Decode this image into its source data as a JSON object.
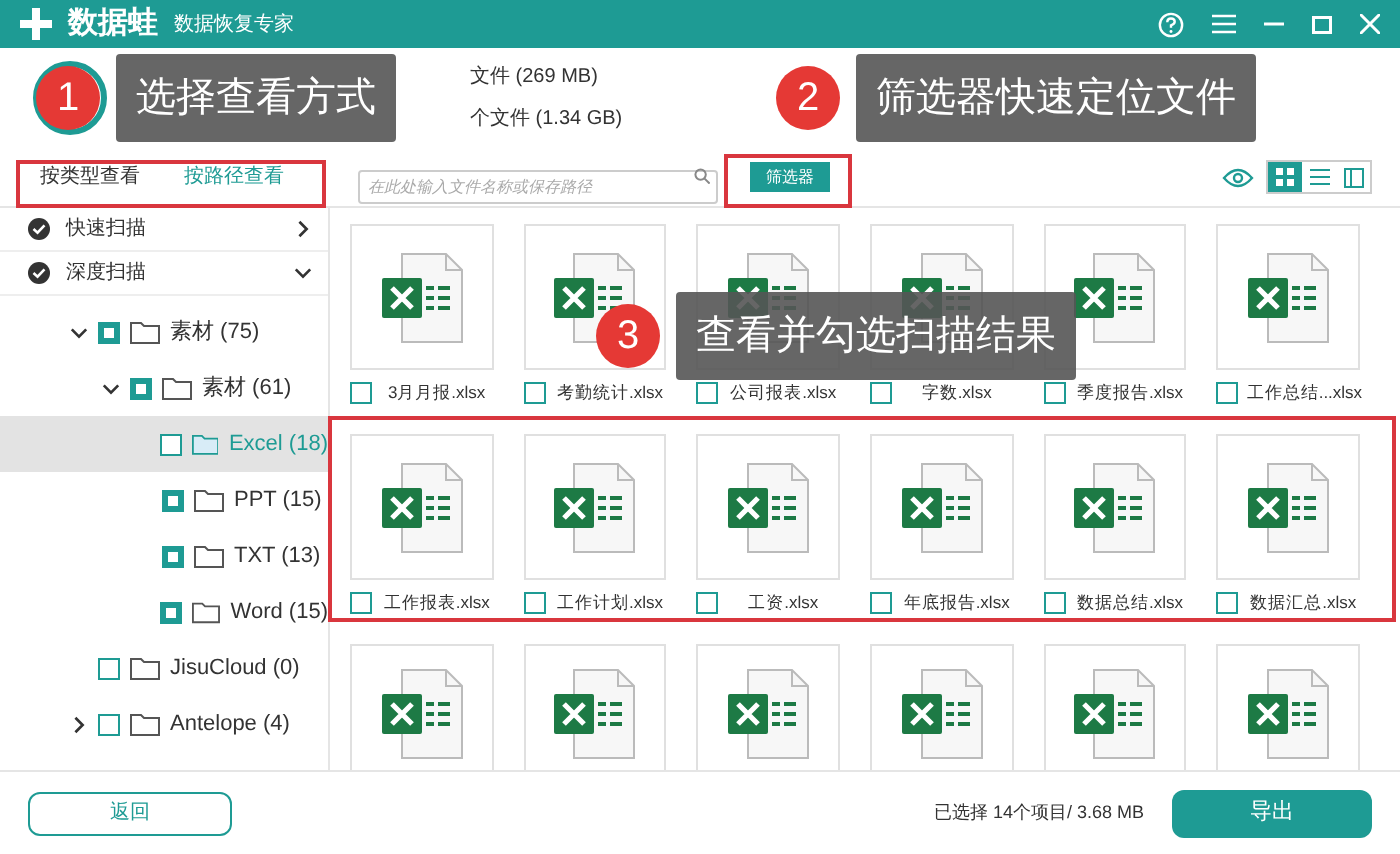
{
  "window": {
    "app_name": "数据蛙",
    "subtitle": "数据恢复专家"
  },
  "summary": [
    "文件 (269 MB)",
    "个文件 (1.34 GB)"
  ],
  "view_tabs": [
    {
      "label": "按类型查看",
      "selected": false
    },
    {
      "label": "按路径查看",
      "selected": true
    }
  ],
  "search": {
    "placeholder": "在此处输入文件名称或保存路径"
  },
  "filter_button": "筛选器",
  "view_modes": [
    {
      "kind": "grid",
      "selected": true
    },
    {
      "kind": "list",
      "selected": false
    },
    {
      "kind": "detail",
      "selected": false
    }
  ],
  "scan_modes": [
    {
      "label": "快速扫描",
      "expanded": false
    },
    {
      "label": "深度扫描",
      "expanded": true
    }
  ],
  "tree": [
    {
      "label": "素材 (75)",
      "checked": true,
      "expanded": true,
      "selected": false,
      "children": [
        {
          "label": "素材 (61)",
          "checked": true,
          "expanded": true,
          "selected": false,
          "children": [
            {
              "label": "Excel (18)",
              "checked": false,
              "selected": true
            },
            {
              "label": "PPT (15)",
              "checked": true,
              "selected": false
            },
            {
              "label": "TXT (13)",
              "checked": true,
              "selected": false
            },
            {
              "label": "Word (15)",
              "checked": true,
              "selected": false
            }
          ]
        }
      ]
    },
    {
      "label": "JisuCloud (0)",
      "checked": false,
      "selected": false
    },
    {
      "label": "Antelope (4)",
      "checked": false,
      "expanded": false,
      "selected": false,
      "expandable": true
    }
  ],
  "files": [
    {
      "kind": "named",
      "name": "3月月报.xlsx",
      "checked": false
    },
    {
      "kind": "named",
      "name": "考勤统计.xlsx",
      "checked": false
    },
    {
      "kind": "named",
      "name": "公司报表.xlsx",
      "checked": false
    },
    {
      "kind": "named",
      "name": "字数.xlsx",
      "checked": false
    },
    {
      "kind": "named",
      "name": "季度报告.xlsx",
      "checked": false
    },
    {
      "kind": "named",
      "name": "工作总结...xlsx",
      "checked": false
    },
    {
      "kind": "named",
      "name": "工作报表.xlsx",
      "checked": false
    },
    {
      "kind": "named",
      "name": "工作计划.xlsx",
      "checked": false
    },
    {
      "kind": "named",
      "name": "工资.xlsx",
      "checked": false
    },
    {
      "kind": "named",
      "name": "年底报告.xlsx",
      "checked": false
    },
    {
      "kind": "named",
      "name": "数据总结.xlsx",
      "checked": false
    },
    {
      "kind": "named",
      "name": "数据汇总.xlsx",
      "checked": false
    },
    {
      "kind": "thumbnail_only"
    },
    {
      "kind": "thumbnail_only"
    },
    {
      "kind": "thumbnail_only"
    },
    {
      "kind": "thumbnail_only"
    },
    {
      "kind": "thumbnail_only"
    },
    {
      "kind": "thumbnail_only"
    }
  ],
  "back_button": "返回",
  "status": "已选择 14个项目/ 3.68 MB",
  "export_button": "导出",
  "callouts": [
    {
      "number": "1",
      "text": "选择查看方式"
    },
    {
      "number": "2",
      "text": "筛选器快速定位文件"
    },
    {
      "number": "3",
      "text": "查看并勾选扫描结果"
    }
  ]
}
